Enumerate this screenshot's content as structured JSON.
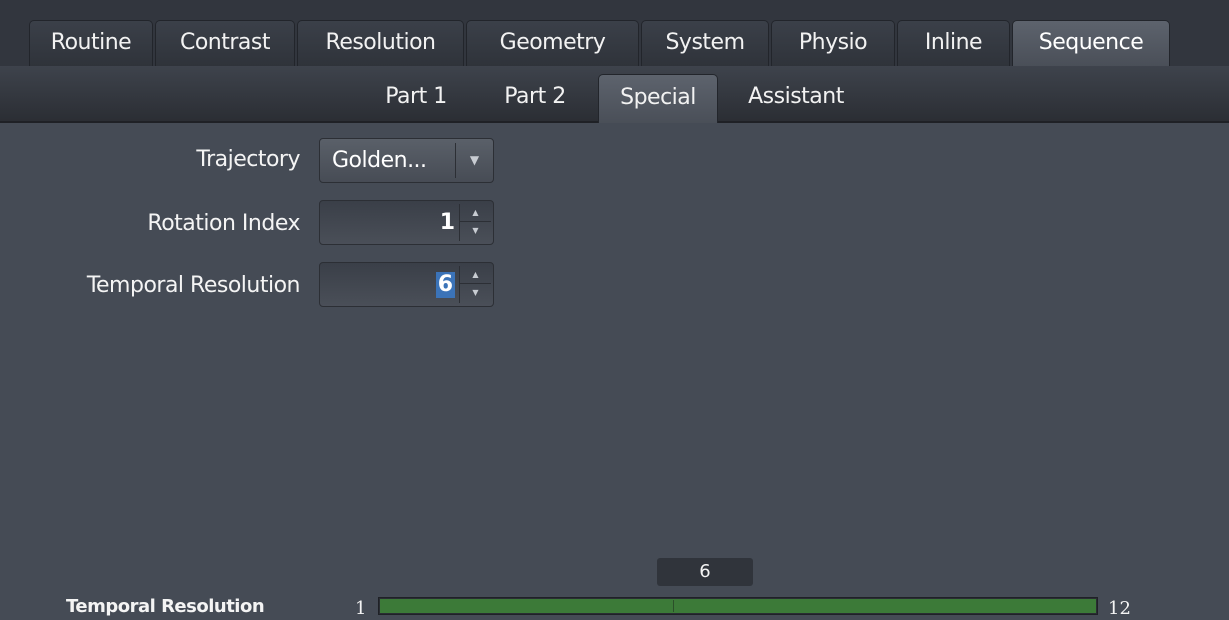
{
  "tabs": [
    {
      "label": "Routine",
      "active": false
    },
    {
      "label": "Contrast",
      "active": false
    },
    {
      "label": "Resolution",
      "active": false
    },
    {
      "label": "Geometry",
      "active": false
    },
    {
      "label": "System",
      "active": false
    },
    {
      "label": "Physio",
      "active": false
    },
    {
      "label": "Inline",
      "active": false
    },
    {
      "label": "Sequence",
      "active": true
    }
  ],
  "subtabs": [
    {
      "label": "Part 1",
      "active": false
    },
    {
      "label": "Part 2",
      "active": false
    },
    {
      "label": "Special",
      "active": true
    },
    {
      "label": "Assistant",
      "active": false
    }
  ],
  "fields": {
    "trajectory": {
      "label": "Trajectory",
      "value": "Golden...",
      "icon": "chevron-down-icon"
    },
    "rotation_index": {
      "label": "Rotation Index",
      "value": "1"
    },
    "temporal_resolution": {
      "label": "Temporal Resolution",
      "value": "6"
    }
  },
  "range": {
    "label": "Temporal Resolution",
    "min": "1",
    "max": "12",
    "current": "6",
    "current_value": 6,
    "fill_fraction": 1.0,
    "fill_color": "#3c7a38"
  },
  "colors": {
    "background": "#454b55",
    "selection": "#3b73b8"
  }
}
